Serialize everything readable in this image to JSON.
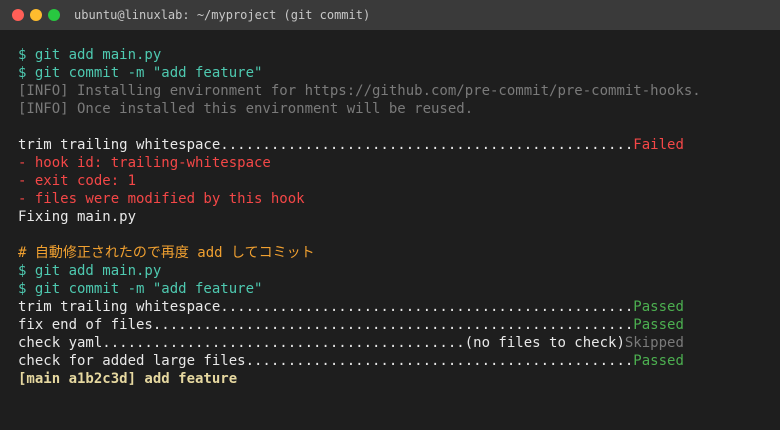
{
  "window": {
    "title": "ubuntu@linuxlab: ~/myproject (git commit)"
  },
  "lines": [
    {
      "segments": [
        {
          "text": "$ git add main.py",
          "style": "cmd"
        }
      ]
    },
    {
      "segments": [
        {
          "text": "$ git commit -m \"add feature\"",
          "style": "cmd"
        }
      ]
    },
    {
      "segments": [
        {
          "text": "[INFO] Installing environment for https://github.com/pre-commit/pre-commit-hooks.",
          "style": "info"
        }
      ]
    },
    {
      "segments": [
        {
          "text": "[INFO] Once installed this environment will be reused.",
          "style": "info"
        }
      ]
    },
    {
      "segments": []
    },
    {
      "segments": [
        {
          "text": "trim trailing whitespace.................................................",
          "style": "normal"
        },
        {
          "text": "Failed",
          "style": "err"
        }
      ]
    },
    {
      "segments": [
        {
          "text": "- hook id: trailing-whitespace",
          "style": "err"
        }
      ]
    },
    {
      "segments": [
        {
          "text": "- exit code: 1",
          "style": "err"
        }
      ]
    },
    {
      "segments": [
        {
          "text": "- files were modified by this hook",
          "style": "err"
        }
      ]
    },
    {
      "segments": [
        {
          "text": "Fixing main.py",
          "style": "normal"
        }
      ]
    },
    {
      "segments": []
    },
    {
      "segments": [
        {
          "text": "# 自動修正されたので再度 add してコミット",
          "style": "comment"
        }
      ]
    },
    {
      "segments": [
        {
          "text": "$ git add main.py",
          "style": "cmd"
        }
      ]
    },
    {
      "segments": [
        {
          "text": "$ git commit -m \"add feature\"",
          "style": "cmd"
        }
      ]
    },
    {
      "segments": [
        {
          "text": "trim trailing whitespace.................................................",
          "style": "normal"
        },
        {
          "text": "Passed",
          "style": "ok"
        }
      ]
    },
    {
      "segments": [
        {
          "text": "fix end of files.........................................................",
          "style": "normal"
        },
        {
          "text": "Passed",
          "style": "ok"
        }
      ]
    },
    {
      "segments": [
        {
          "text": "check yaml...........................................(no files to check)",
          "style": "normal"
        },
        {
          "text": "Skipped",
          "style": "skip"
        }
      ]
    },
    {
      "segments": [
        {
          "text": "check for added large files..............................................",
          "style": "normal"
        },
        {
          "text": "Passed",
          "style": "ok"
        }
      ]
    },
    {
      "segments": [
        {
          "text": "[main a1b2c3d] add feature",
          "style": "bold"
        }
      ]
    }
  ],
  "colors": {
    "cmd": "#4ec9b0",
    "info": "#7a7a7a",
    "normal": "#e8e8e8",
    "err": "#f44747",
    "comment": "#f0a030",
    "ok": "#4caf50",
    "skip": "#7a7a7a",
    "bold": "#e6d8a0"
  },
  "icons": {
    "close": "close-dot-icon",
    "minimize": "minimize-dot-icon",
    "maximize": "maximize-dot-icon"
  }
}
